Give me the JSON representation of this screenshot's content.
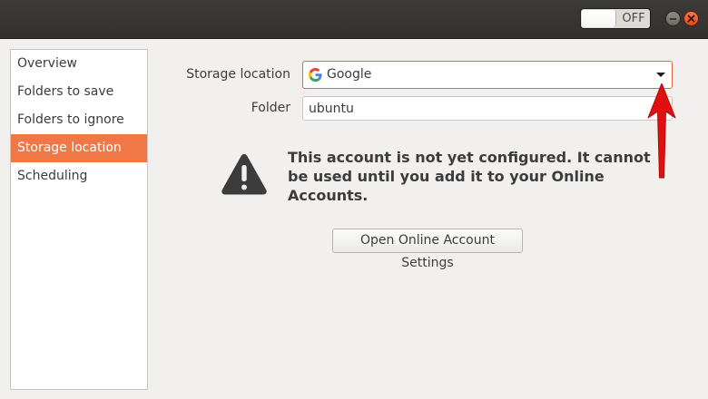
{
  "header": {
    "toggle_label": "OFF"
  },
  "sidebar": {
    "items": [
      {
        "label": "Overview"
      },
      {
        "label": "Folders to save"
      },
      {
        "label": "Folders to ignore"
      },
      {
        "label": "Storage location",
        "selected": true
      },
      {
        "label": "Scheduling"
      }
    ]
  },
  "form": {
    "storage_label": "Storage location",
    "storage_value": "Google",
    "storage_icon": "google-icon",
    "folder_label": "Folder",
    "folder_value": "ubuntu"
  },
  "warning": {
    "icon": "warning-icon",
    "message": "This account is not yet configured. It cannot be used until you add it to your Online Accounts."
  },
  "actions": {
    "open_settings_label": "Open Online Account Settings"
  },
  "colors": {
    "accent": "#f07746",
    "header_bg": "#3d3b37",
    "window_bg": "#f1f0ee",
    "annotation_arrow": "#e01010"
  }
}
